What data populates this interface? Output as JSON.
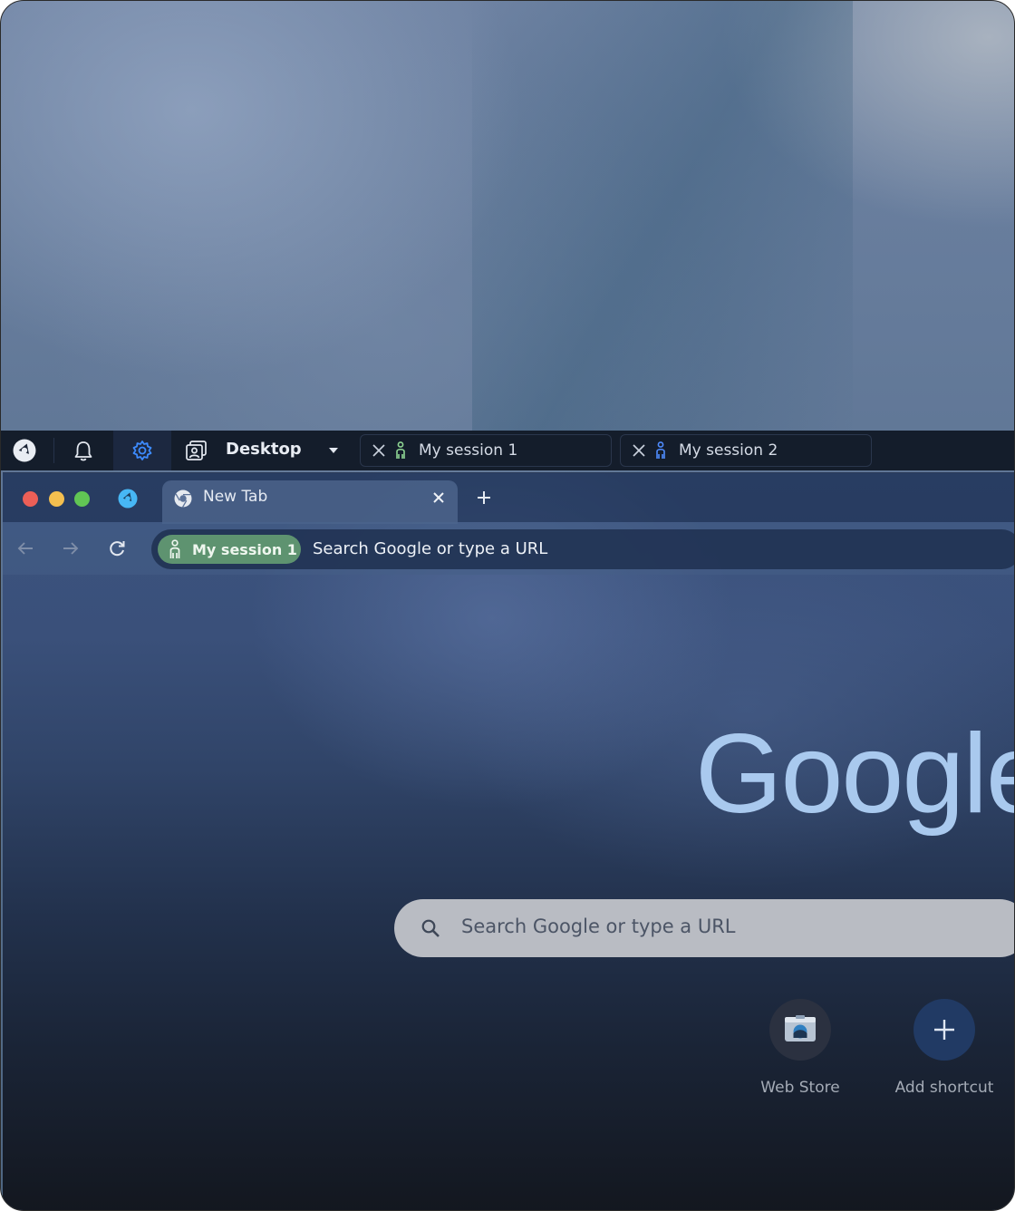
{
  "topbar": {
    "logo_icon": "app-logo-icon",
    "notifications_icon": "bell-icon",
    "settings_icon": "gear-icon",
    "desktop_icon": "desktop-profile-icon",
    "desktop_label": "Desktop",
    "dropdown_icon": "caret-down-icon",
    "sessions": [
      {
        "label": "My session 1",
        "person_color": "#8fd694"
      },
      {
        "label": "My session 2",
        "person_color": "#4f8cff"
      }
    ]
  },
  "browser": {
    "traffic_lights": {
      "close": "#ec5f57",
      "minimize": "#f4bf4f",
      "maximize": "#61c554"
    },
    "tab": {
      "label": "New Tab",
      "icon": "chrome-icon",
      "close_icon": "close-icon"
    },
    "new_tab_icon": "plus-icon",
    "omnibox": {
      "session_chip": "My session 1",
      "placeholder": "Search Google or type a URL"
    }
  },
  "newtab_page": {
    "logo_text": "Google",
    "search_placeholder": "Search Google or type a URL",
    "shortcuts": [
      {
        "label": "Web Store",
        "icon": "web-store-icon"
      },
      {
        "label": "Add shortcut",
        "icon": "plus-icon"
      }
    ]
  }
}
